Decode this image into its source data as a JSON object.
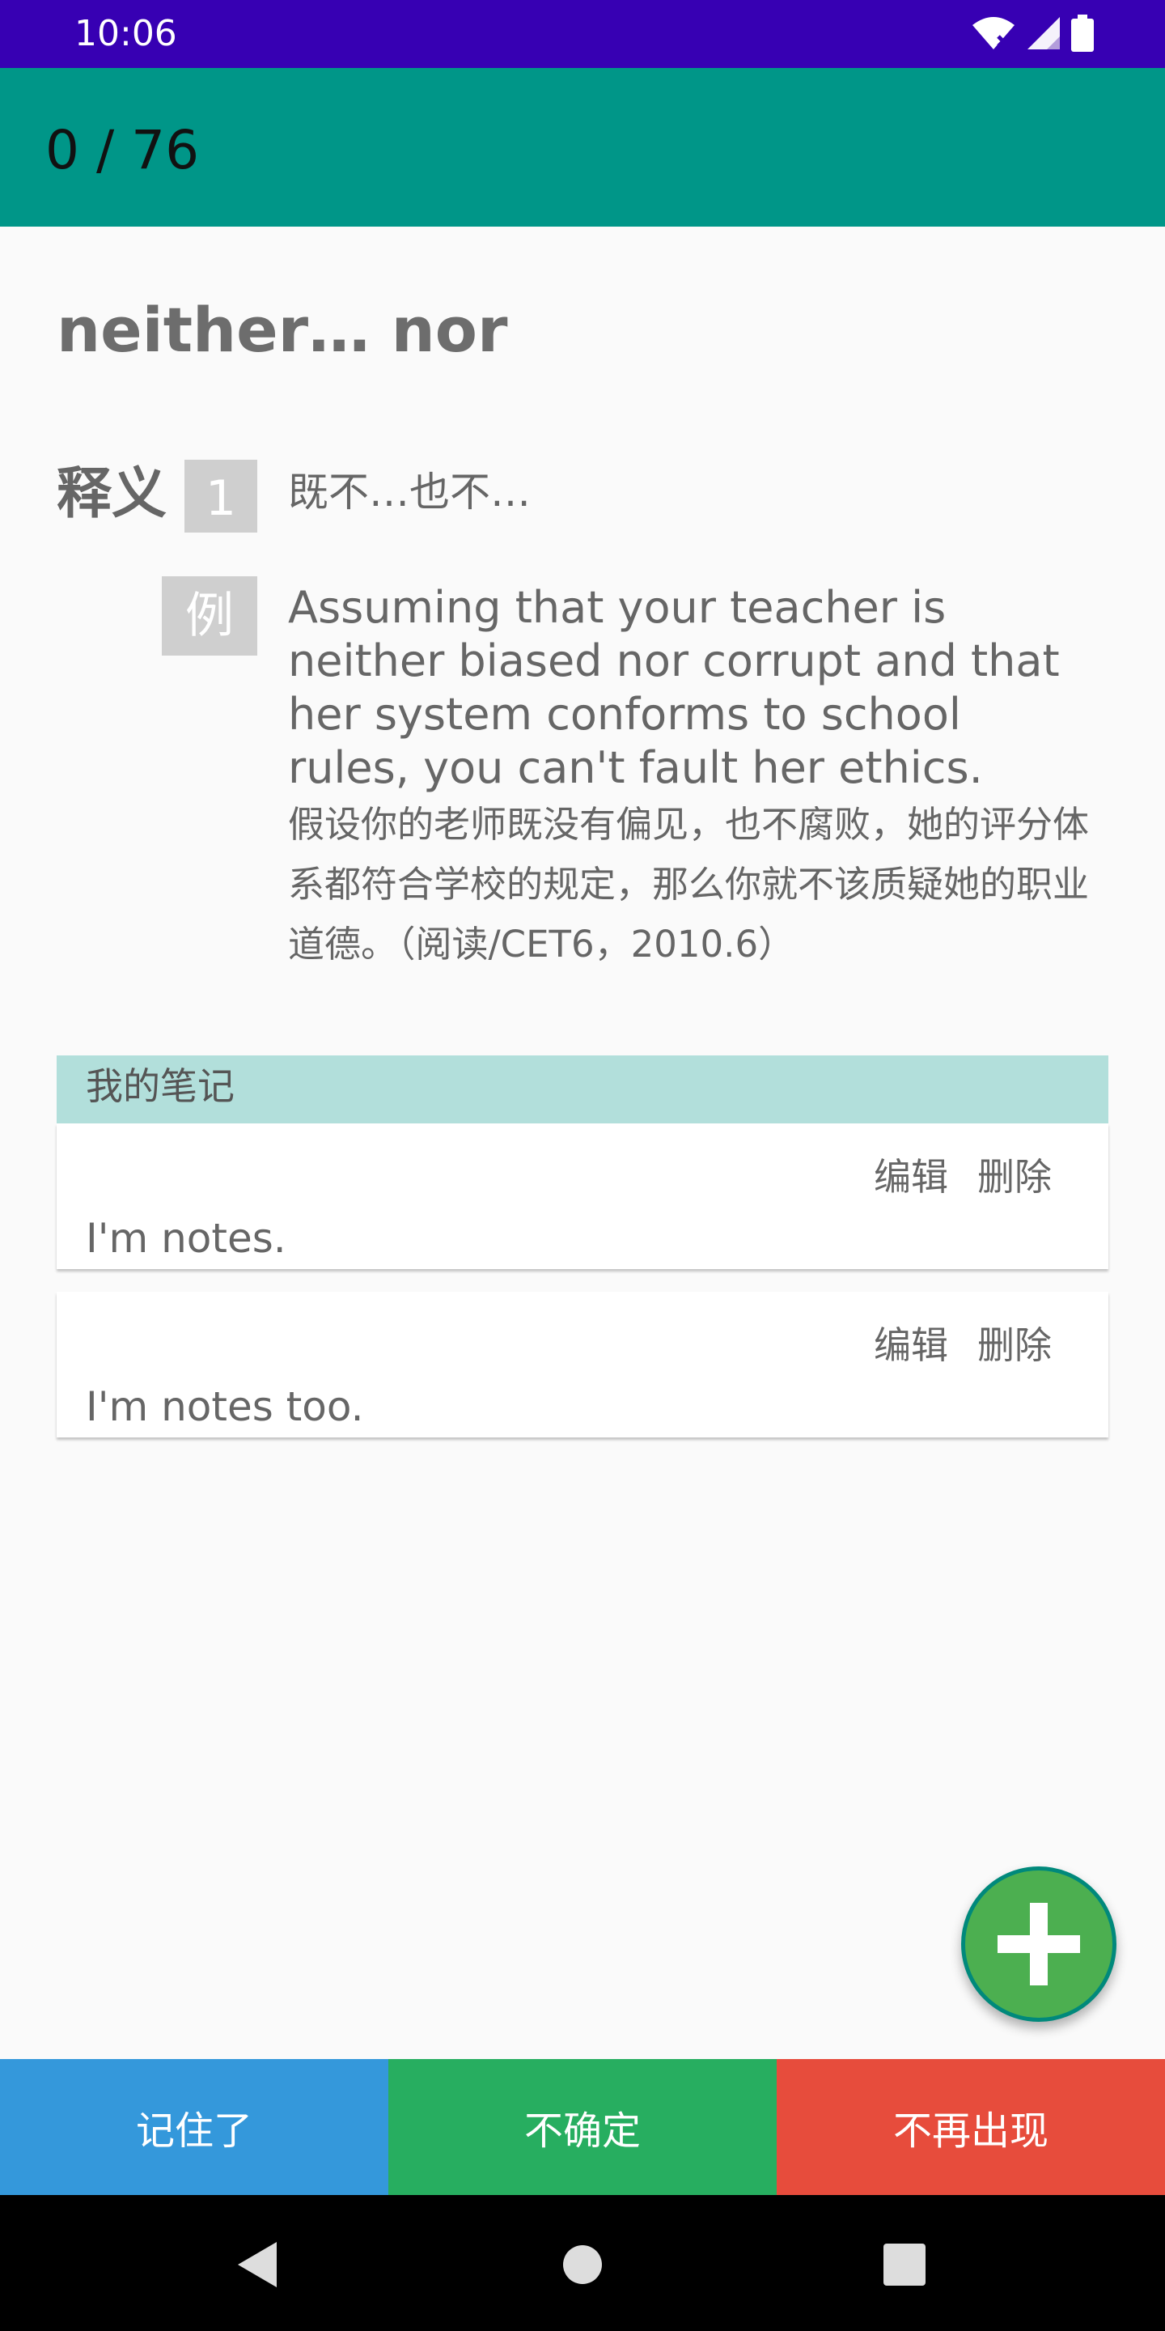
{
  "status_bar": {
    "time": "10:06"
  },
  "app_bar": {
    "title": "0 / 76"
  },
  "entry": {
    "word": "neither… nor",
    "definition_label": "释义",
    "definition_number": "1",
    "definition_text": "既不…也不…",
    "example_badge": "例",
    "example_en": "Assuming that your teacher is neither biased nor corrupt and that her system conforms to school rules, you can't fault her ethics.",
    "example_cn": "假设你的老师既没有偏见，也不腐败，她的评分体系都符合学校的规定，那么你就不该质疑她的职业道德。（阅读/CET6，2010.6）"
  },
  "notes": {
    "header": "我的笔记",
    "items": [
      {
        "edit_label": "编辑",
        "delete_label": "删除",
        "text": "I'm notes."
      },
      {
        "edit_label": "编辑",
        "delete_label": "删除",
        "text": "I'm notes too."
      }
    ]
  },
  "bottom_buttons": {
    "remembered": {
      "label": "记住了",
      "color": "#3498db"
    },
    "unsure": {
      "label": "不确定",
      "color": "#27ae60"
    },
    "never_show": {
      "label": "不再出现",
      "color": "#e74c3c"
    }
  },
  "colors": {
    "status_bar": "#3700b3",
    "app_bar": "#009688",
    "notes_header": "#b2dfdb",
    "fab": "#4caf50"
  },
  "icons": {
    "fab": "plus-icon",
    "status": [
      "wifi-icon",
      "signal-icon",
      "battery-icon"
    ],
    "nav": [
      "back-icon",
      "home-icon",
      "recents-icon"
    ]
  }
}
